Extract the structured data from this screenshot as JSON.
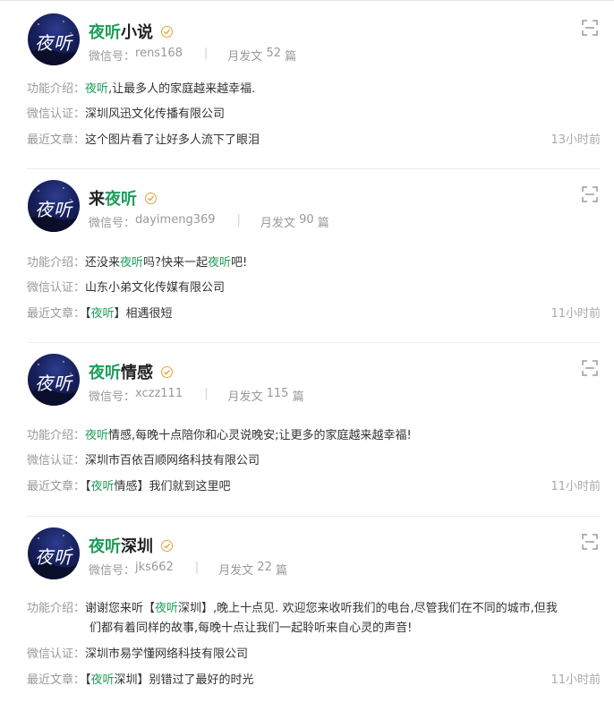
{
  "accounts": [
    {
      "name_parts": [
        "夜听",
        "小说"
      ],
      "avatar_text": "夜听",
      "wechat_id_label": "微信号：",
      "wechat_id": "rens168",
      "posts_label": "月发文",
      "posts_count": "52",
      "posts_unit": "篇",
      "intro_label": "功能介绍：",
      "intro_parts": [
        "夜听",
        ",让最多人的家庭越来越幸福."
      ],
      "cert_label": "微信认证：",
      "cert": "深圳风迅文化传播有限公司",
      "recent_label": "最近文章：",
      "recent_parts": [
        "这个图片看了让好多人流下了眼泪"
      ],
      "recent_time": "13小时前"
    },
    {
      "name_parts": [
        "来",
        "夜听"
      ],
      "avatar_text": "夜听",
      "wechat_id_label": "微信号：",
      "wechat_id": "dayimeng369",
      "posts_label": "月发文",
      "posts_count": "90",
      "posts_unit": "篇",
      "intro_label": "功能介绍：",
      "intro_parts": [
        "还没来",
        "夜听",
        "吗?快来一起",
        "夜听",
        "吧!"
      ],
      "cert_label": "微信认证：",
      "cert": "山东小弟文化传媒有限公司",
      "recent_label": "最近文章：",
      "recent_parts": [
        "【",
        "夜听",
        "】相遇很短"
      ],
      "recent_time": "11小时前"
    },
    {
      "name_parts": [
        "夜听",
        "情感"
      ],
      "avatar_text": "夜听",
      "wechat_id_label": "微信号：",
      "wechat_id": "xczz111",
      "posts_label": "月发文",
      "posts_count": "115",
      "posts_unit": "篇",
      "intro_label": "功能介绍：",
      "intro_parts": [
        "夜听",
        "情感,每晚十点陪你和心灵说晚安;让更多的家庭越来越幸福!"
      ],
      "cert_label": "微信认证：",
      "cert": "深圳市百依百顺网络科技有限公司",
      "recent_label": "最近文章：",
      "recent_parts": [
        "【",
        "夜听",
        "情感】我们就到这里吧"
      ],
      "recent_time": "11小时前"
    },
    {
      "name_parts": [
        "夜听",
        "深圳"
      ],
      "avatar_text": "夜听",
      "wechat_id_label": "微信号：",
      "wechat_id": "jks662",
      "posts_label": "月发文",
      "posts_count": "22",
      "posts_unit": "篇",
      "intro_label": "功能介绍：",
      "intro_parts": [
        "谢谢您来听【",
        "夜听",
        "深圳】,晚上十点见. 欢迎您来收听我们的电台,尽管我们在不同的城市,但我",
        "们都有着同样的故事,每晚十点让我们一起聆听来自心灵的声音!"
      ],
      "cert_label": "微信认证：",
      "cert": "深圳市易学懂网络科技有限公司",
      "recent_label": "最近文章：",
      "recent_parts": [
        "【",
        "夜听",
        "深圳】别错过了最好的时光"
      ],
      "recent_time": "11小时前"
    }
  ],
  "colors": {
    "highlight": "#1c9d59",
    "label": "#999999",
    "verify": "#e0a43c"
  },
  "icons": {
    "verified": "verified-badge-icon",
    "qr": "qr-code-icon"
  }
}
